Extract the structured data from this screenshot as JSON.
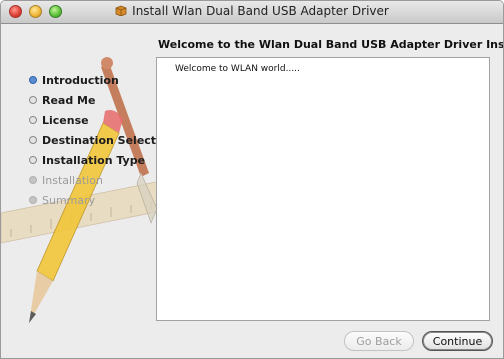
{
  "window": {
    "title": "Install Wlan Dual Band USB Adapter Driver",
    "heading": "Welcome to the Wlan Dual Band USB Adapter Driver Installer"
  },
  "sidebar": {
    "steps": [
      {
        "label": "Introduction",
        "state": "active"
      },
      {
        "label": "Read Me",
        "state": "pending"
      },
      {
        "label": "License",
        "state": "pending"
      },
      {
        "label": "Destination Select",
        "state": "pending"
      },
      {
        "label": "Installation Type",
        "state": "pending"
      },
      {
        "label": "Installation",
        "state": "disabled"
      },
      {
        "label": "Summary",
        "state": "disabled"
      }
    ]
  },
  "content": {
    "text": "Welcome to WLAN world....."
  },
  "buttons": {
    "back_label": "Go Back",
    "continue_label": "Continue"
  },
  "colors": {
    "active_bullet": "#5b8ed0",
    "window_bg": "#ececec"
  }
}
